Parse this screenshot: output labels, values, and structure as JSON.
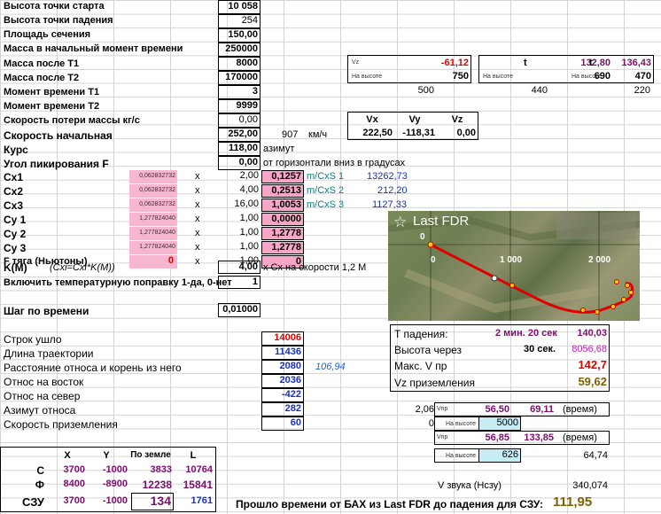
{
  "rows": [
    {
      "label": "Высота точки старта",
      "value": "10 058"
    },
    {
      "label": "Высота точки падения",
      "value": "254"
    },
    {
      "label": "Площадь сечения",
      "value": "150,00"
    },
    {
      "label": "Масса в начальный момент времени",
      "value": "250000"
    },
    {
      "label": "Масса после T1",
      "value": "8000"
    },
    {
      "label": "Масса после T2",
      "value": "170000"
    },
    {
      "label": "Момент времени T1",
      "value": "3"
    },
    {
      "label": "Момент времени T2",
      "value": "9999"
    },
    {
      "label": "Скорость потери массы кг/с",
      "value": "0,00"
    },
    {
      "label": "Скорость начальная",
      "value": "252,00",
      "extra": "907",
      "unit": "км/ч"
    },
    {
      "label": "Курс",
      "value": "118,00",
      "unit": "азимут"
    },
    {
      "label": "Угол пикирования F",
      "value": "0,00",
      "unit": "от горизонтали вниз в градусах"
    }
  ],
  "coeffs": [
    {
      "label": "Cx1",
      "pink": "0,062832732",
      "x": "x",
      "value": "2,00",
      "result": "0,1257",
      "unit": "m/CxS 1",
      "extra": "13262,73"
    },
    {
      "label": "Cx2",
      "pink": "0,062832732",
      "x": "x",
      "value": "4,00",
      "result": "0,2513",
      "unit": "m/CxS 2",
      "extra": "212,20"
    },
    {
      "label": "Cx3",
      "pink": "0,062832732",
      "x": "x",
      "value": "16,00",
      "result": "1,0053",
      "unit": "m/CxS 3",
      "extra": "1127,33"
    },
    {
      "label": "Cy 1",
      "pink": "1,277824040",
      "x": "x",
      "value": "1,00",
      "result": "0,0000"
    },
    {
      "label": "Cy 2",
      "pink": "1,277824040",
      "x": "x",
      "value": "1,00",
      "result": "1,2778"
    },
    {
      "label": "Cy 3",
      "pink": "1,277824040",
      "x": "x",
      "value": "1,00",
      "result": "1,2778"
    },
    {
      "label": "F тяга (Ньютоны)",
      "pink": "0",
      "x": "x",
      "value": "1,00",
      "result": "0"
    }
  ],
  "km": {
    "label": "K(M)",
    "formula": "(Cxi=Cxi*K(M))",
    "value": "4,00",
    "note": "x Cx на скорости 1,2 M"
  },
  "temp": {
    "label": "Включить температурную поправку 1-да, 0-нет",
    "value": "1"
  },
  "step": {
    "label": "Шаг по времени",
    "value": "0,01000"
  },
  "results": [
    {
      "label": "Строк ушло",
      "value": "14006",
      "color": "#e00000"
    },
    {
      "label": "Длина траектории",
      "value": "11436",
      "color": "#1530c8"
    },
    {
      "label": "Расстояние относа и корень из него",
      "value": "2080",
      "color": "#1530c8",
      "extra": "106,94"
    },
    {
      "label": "Относ на восток",
      "value": "2036",
      "color": "#1530c8"
    },
    {
      "label": "Относ на север",
      "value": "-422",
      "color": "#1530c8"
    },
    {
      "label": "Азимут относа",
      "value": "282",
      "color": "#1530c8"
    },
    {
      "label": "Скорость приземления",
      "value": "60",
      "color": "#1530c8"
    }
  ],
  "vz_box": {
    "vz_label": "Vz",
    "vz": "-61,12",
    "h_label": "На высоте",
    "h": "750",
    "below": "500"
  },
  "t_box": {
    "t1_label": "t",
    "t1": "132,80",
    "t2_label": "t",
    "t2": "136,43",
    "h1_label": "На высоте",
    "h1": "690",
    "h2_label": "На высоте",
    "h2": "470",
    "below1": "440",
    "below2": "220"
  },
  "v_box": {
    "h": [
      "Vx",
      "Vy",
      "Vz"
    ],
    "v": [
      "222,50",
      "-118,31",
      "0,00"
    ]
  },
  "map": {
    "title": "Last FDR",
    "ticks": [
      "0",
      "1 000",
      "2 000"
    ],
    "zero_y": "0"
  },
  "fall": [
    {
      "label": "T падения:",
      "value": "2 мин. 20 сек",
      "extra": "140,03"
    },
    {
      "label": "Высота через",
      "value": "30 сек.",
      "extra": "8056,68"
    },
    {
      "label": "Макс. V пр",
      "extra": "142,7"
    },
    {
      "label": "Vz приземления",
      "extra": "59,62"
    }
  ],
  "vpr": {
    "r1_left": "2,06",
    "r1_label": "Vпр",
    "r1_v": "56,50",
    "r1_t": "69,11",
    "r1_unit": "(время)",
    "r2_left": "0",
    "r2_label": "На высоте",
    "r2_h": "5000",
    "r3_label": "Vпр",
    "r3_v": "56,85",
    "r3_t": "133,85",
    "r3_unit": "(время)",
    "r4_label": "На высоте",
    "r4_h": "626",
    "r4_extra": "64,74",
    "sound_label": "V звука (Нсзу)",
    "sound": "340,074"
  },
  "xy": {
    "headers": [
      "X",
      "Y",
      "По земле",
      "L"
    ],
    "rows": [
      {
        "name": "С",
        "x": "3700",
        "y": "-1000",
        "g": "3833",
        "l": "10764"
      },
      {
        "name": "Ф",
        "x": "8400",
        "y": "-8900",
        "g": "12238",
        "l": "15841"
      },
      {
        "name": "СЗУ",
        "x": "3700",
        "y": "-1000",
        "g": "134",
        "l": "1761"
      }
    ]
  },
  "final": {
    "label": "Прошло времени от БАХ из Last FDR до падения для СЗУ:",
    "value": "111,95"
  },
  "colors": {
    "pink": "#f7a6c8",
    "cyan": "#c8ecf4",
    "red": "#e00000",
    "purple": "#7a0f6b",
    "blue": "#1530c8",
    "track": "#e00000",
    "marker": "#ffd400"
  }
}
